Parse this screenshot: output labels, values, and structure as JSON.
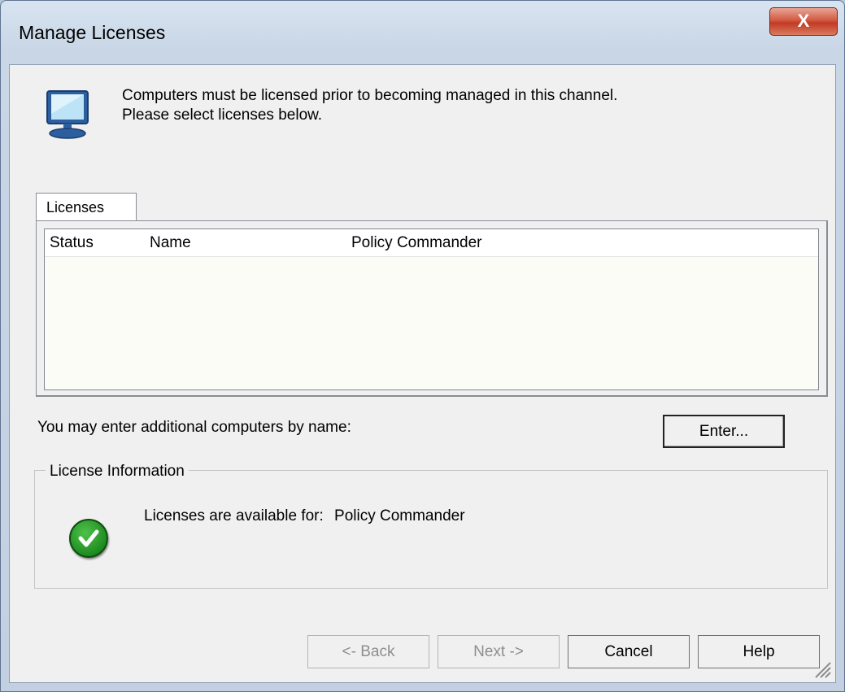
{
  "window": {
    "title": "Manage Licenses",
    "close_glyph": "X"
  },
  "header": {
    "icon": "computer-monitor-icon",
    "line1": "Computers must be licensed prior to becoming managed in this channel.",
    "line2": "Please select licenses below."
  },
  "tabs": [
    {
      "label": "Licenses",
      "selected": true
    }
  ],
  "license_table": {
    "columns": [
      "Status",
      "Name",
      "Policy Commander"
    ],
    "rows": []
  },
  "enter_prompt": "You may enter additional computers by name:",
  "enter_button": "Enter...",
  "license_info": {
    "legend": "License Information",
    "status_icon": "green-checkmark-icon",
    "available_label": "Licenses are available for:",
    "available_value": "Policy Commander"
  },
  "footer_buttons": {
    "back": "<- Back",
    "next": "Next ->",
    "cancel": "Cancel",
    "help": "Help"
  },
  "colors": {
    "titlebar": "#c8d6e6",
    "close": "#c23a24",
    "client": "#f0f0f0",
    "check": "#1e8b20"
  }
}
